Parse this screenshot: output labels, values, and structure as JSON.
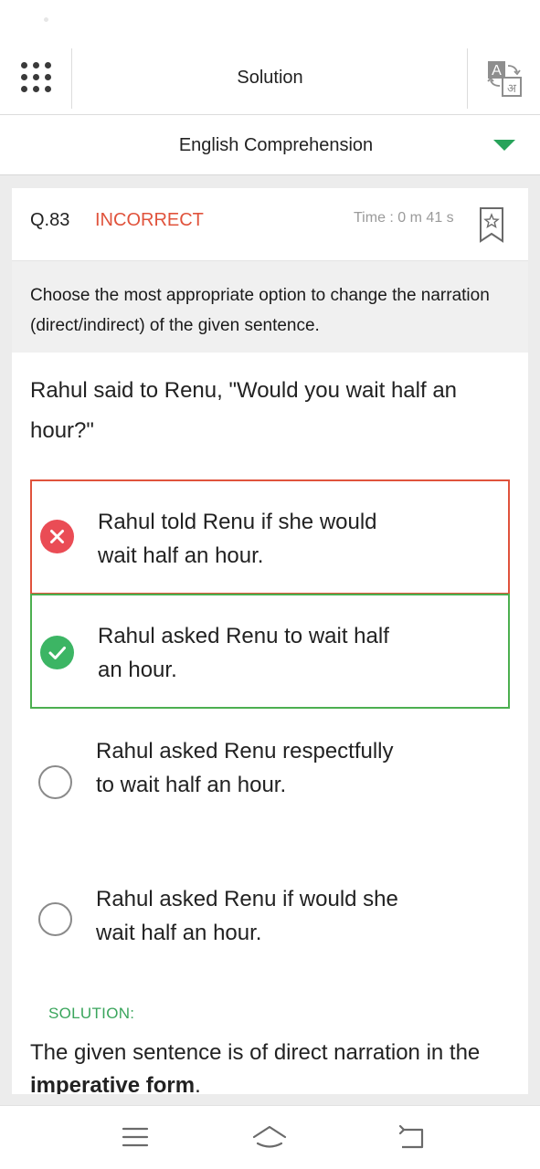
{
  "app_bar": {
    "title": "Solution",
    "menu_icon": "grid-menu-icon",
    "translate_icon": "translate-icon",
    "translate_glyph_en": "A",
    "translate_glyph_hi": "अ"
  },
  "section": {
    "selected": "English Comprehension",
    "dropdown_icon": "caret-down-icon",
    "accent_color": "#27a35a"
  },
  "question": {
    "number": "Q.83",
    "status": "INCORRECT",
    "status_color": "#e0533c",
    "time": "Time : 0 m 41 s",
    "bookmark_icon": "bookmark-star-icon",
    "instruction": "Choose the most appropriate option to change the narration (direct/indirect) of the given sentence.",
    "text": "Rahul said to Renu, \"Would you wait half an hour?\""
  },
  "options": [
    {
      "text": "Rahul told Renu if she would wait half an hour.",
      "state": "incorrect-selected",
      "icon": "cross-circle-icon",
      "color": "#e0533c"
    },
    {
      "text": "Rahul asked Renu to wait half an hour.",
      "state": "correct",
      "icon": "check-circle-icon",
      "color": "#4caf50"
    },
    {
      "text": "Rahul asked Renu respectfully to wait half an hour.",
      "state": "unselected",
      "icon": "radio-empty-icon"
    },
    {
      "text": "Rahul asked Renu if would she wait half an hour.",
      "state": "unselected",
      "icon": "radio-empty-icon"
    }
  ],
  "solution": {
    "label": "SOLUTION:",
    "text_prefix": "The given sentence is of direct narration in the ",
    "text_bold": "imperative form",
    "text_suffix": "."
  },
  "nav_bar": {
    "menu_icon": "recent-apps-icon",
    "home_icon": "home-icon",
    "back_icon": "back-icon"
  }
}
